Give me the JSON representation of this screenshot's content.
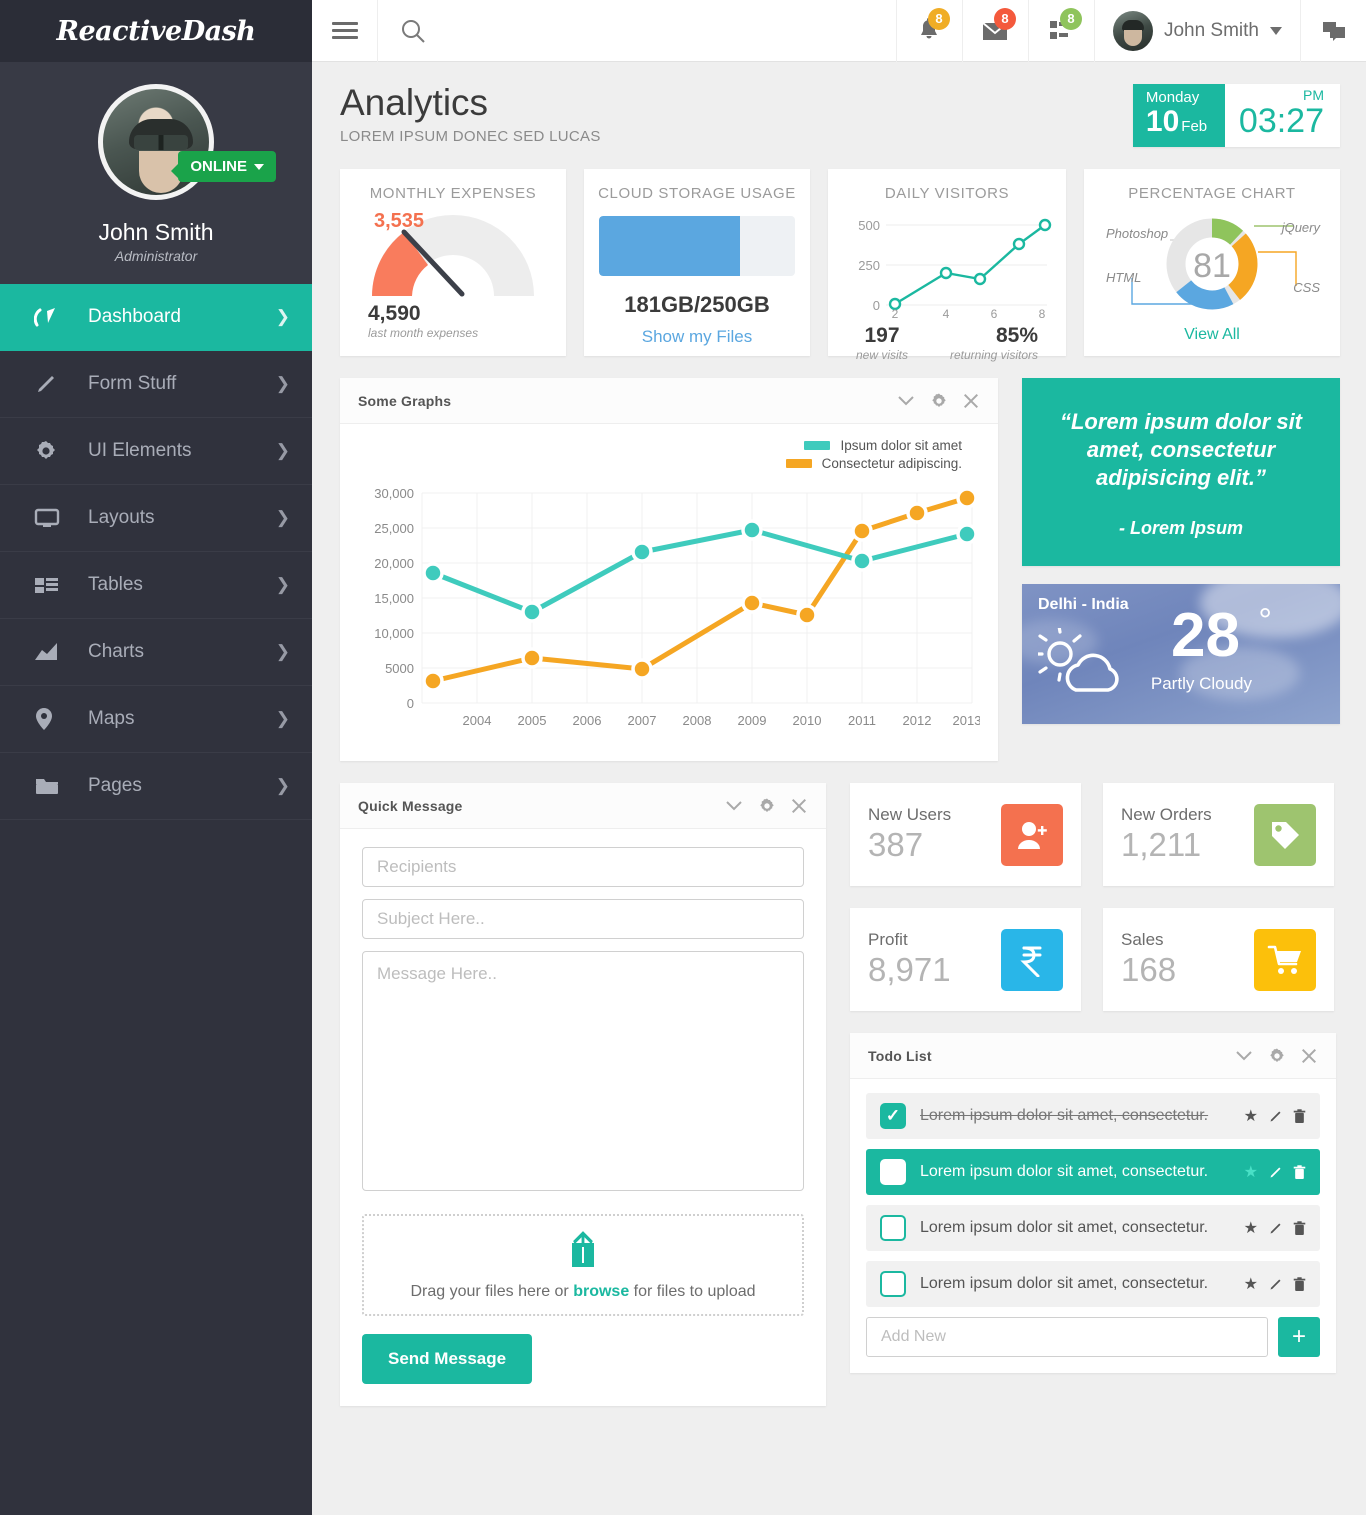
{
  "brand": {
    "name": "ReactiveDash"
  },
  "profile": {
    "name": "John Smith",
    "role": "Administrator",
    "status": "ONLINE"
  },
  "sidebar": {
    "items": [
      {
        "label": "Dashboard",
        "icon": "dashboard-icon",
        "active": true
      },
      {
        "label": "Form Stuff",
        "icon": "pencil-icon",
        "active": false
      },
      {
        "label": "UI Elements",
        "icon": "gear-icon",
        "active": false
      },
      {
        "label": "Layouts",
        "icon": "monitor-icon",
        "active": false
      },
      {
        "label": "Tables",
        "icon": "table-icon",
        "active": false
      },
      {
        "label": "Charts",
        "icon": "chart-icon",
        "active": false
      },
      {
        "label": "Maps",
        "icon": "map-pin-icon",
        "active": false
      },
      {
        "label": "Pages",
        "icon": "folder-icon",
        "active": false
      }
    ]
  },
  "topbar": {
    "menu_icon": "hamburger-icon",
    "search_icon": "search-icon",
    "search_placeholder": "",
    "notifications": {
      "icon": "bell-icon",
      "count": "8",
      "color": "#f0ad26"
    },
    "messages": {
      "icon": "envelope-icon",
      "count": "8",
      "color": "#f4593c"
    },
    "tasks": {
      "icon": "tasks-icon",
      "count": "8",
      "color": "#8fc45c"
    },
    "user_name": "John Smith",
    "chat_icon": "chat-bubbles-icon"
  },
  "page": {
    "title": "Analytics",
    "subtitle": "LOREM IPSUM DONEC SED LUCAS"
  },
  "clock": {
    "day": "Monday",
    "date_num": "10",
    "month": "Feb",
    "ampm": "PM",
    "time": "03:27"
  },
  "stats": {
    "expenses": {
      "title": "MONTHLY EXPENSES",
      "gauge_value": "3,535",
      "footer_value": "4,590",
      "footer_label": "last month expenses",
      "accent": "#f4714f"
    },
    "storage": {
      "title": "CLOUD STORAGE USAGE",
      "used_text": "181GB/250GB",
      "percent": 72,
      "link": "Show my Files",
      "accent": "#5ba7e0"
    },
    "visitors": {
      "title": "DAILY VISITORS",
      "new_visits": "197",
      "new_visits_label": "new visits",
      "returning": "85%",
      "returning_label": "returning visitors",
      "accent": "#1bb8a0"
    },
    "percentage": {
      "title": "PERCENTAGE CHART",
      "center_value": "81",
      "labels": [
        "Photoshop",
        "jQuery",
        "CSS",
        "HTML"
      ],
      "link": "View All"
    }
  },
  "chart_data": [
    {
      "type": "line",
      "title": "Some Graphs",
      "series": [
        {
          "name": "Ipsum dolor sit amet",
          "color": "#3fcbbd",
          "values": [
            18600,
            13100,
            21800,
            24700,
            20300,
            24100
          ]
        },
        {
          "name": "Consectetur adipiscing.",
          "color": "#f5a623",
          "values": [
            3200,
            6400,
            4900,
            14300,
            12500,
            24600,
            27200,
            29300
          ]
        }
      ],
      "x": [
        2004,
        2005,
        2006,
        2007,
        2008,
        2009,
        2010,
        2011,
        2012,
        2013
      ],
      "xlabel": "",
      "ylabel": "",
      "ylim": [
        0,
        30000
      ],
      "yticks": [
        0,
        5000,
        10000,
        15000,
        20000,
        25000,
        30000
      ],
      "ytick_labels": [
        "0",
        "5000",
        "10,000",
        "15,000",
        "20,000",
        "25,000",
        "30,000"
      ],
      "xtick_labels": [
        "2004",
        "2005",
        "2006",
        "2007",
        "2008",
        "2009",
        "2010",
        "2011",
        "2012",
        "2013"
      ],
      "grid": true,
      "legend_position": "top-right"
    },
    {
      "type": "line",
      "title": "DAILY VISITORS",
      "x": [
        2,
        4,
        6,
        8
      ],
      "xtick_labels": [
        "2",
        "4",
        "6",
        "8"
      ],
      "yticks": [
        0,
        250,
        500
      ],
      "ytick_labels": [
        "0",
        "250",
        "500"
      ],
      "ylim": [
        0,
        500
      ],
      "values": [
        15,
        200,
        160,
        395,
        495
      ],
      "series": [
        {
          "name": "visitors",
          "color": "#1bb8a0",
          "values": [
            15,
            200,
            160,
            395,
            495
          ]
        }
      ],
      "grid": true,
      "legend_position": "none"
    },
    {
      "type": "pie",
      "title": "PERCENTAGE CHART",
      "labels": [
        "jQuery",
        "CSS",
        "HTML",
        "Photoshop"
      ],
      "values": [
        12,
        26,
        22,
        40
      ],
      "colors": [
        "#8fc45c",
        "#f5a623",
        "#5ba7e0",
        "#e6e6e6"
      ],
      "center_label": "81",
      "legend_position": "around"
    },
    {
      "type": "gauge",
      "title": "MONTHLY EXPENSES",
      "value": 3535,
      "label": "3,535",
      "color": "#f4714f",
      "track_color": "#ededed"
    }
  ],
  "panels": {
    "graphs": {
      "title": "Some Graphs",
      "controls": [
        "chevron-down-icon",
        "gear-icon",
        "close-icon"
      ]
    },
    "quick_message": {
      "title": "Quick Message",
      "controls": [
        "chevron-down-icon",
        "gear-icon",
        "close-icon"
      ],
      "recipients_placeholder": "Recipients",
      "subject_placeholder": "Subject Here..",
      "message_placeholder": "Message Here..",
      "dropzone_text_before": "Drag your files here or ",
      "dropzone_browse": "browse",
      "dropzone_text_after": " for files to upload",
      "send_label": "Send Message"
    },
    "todo": {
      "title": "Todo List",
      "controls": [
        "chevron-down-icon",
        "gear-icon",
        "close-icon"
      ],
      "add_placeholder": "Add New",
      "add_button": "+",
      "items": [
        {
          "text": "Lorem ipsum dolor sit amet, consectetur.",
          "checked": true,
          "highlighted": false
        },
        {
          "text": "Lorem ipsum dolor sit amet, consectetur.",
          "checked": false,
          "highlighted": true
        },
        {
          "text": "Lorem ipsum dolor sit amet, consectetur.",
          "checked": false,
          "highlighted": false
        },
        {
          "text": "Lorem ipsum dolor sit amet, consectetur.",
          "checked": false,
          "highlighted": false
        }
      ]
    }
  },
  "quote": {
    "text": "“Lorem ipsum dolor sit amet, consectetur adipisicing elit.”",
    "author": "- Lorem Ipsum"
  },
  "weather": {
    "city": "Delhi - India",
    "temp": "28",
    "degree": "°",
    "condition": "Partly Cloudy",
    "icon": "sun-cloud-icon"
  },
  "kpis": [
    {
      "label": "New Users",
      "value": "387",
      "icon": "user-add-icon",
      "color": "#f4714f"
    },
    {
      "label": "New Orders",
      "value": "1,211",
      "icon": "tag-icon",
      "color": "#9ec46f"
    },
    {
      "label": "Profit",
      "value": "8,971",
      "icon": "rupee-icon",
      "color": "#29b6e8"
    },
    {
      "label": "Sales",
      "value": "168",
      "icon": "cart-icon",
      "color": "#fcc00b"
    }
  ],
  "colors": {
    "accent_teal": "#1bb8a0",
    "sidebar_bg": "#30323d",
    "page_bg": "#efefef"
  }
}
